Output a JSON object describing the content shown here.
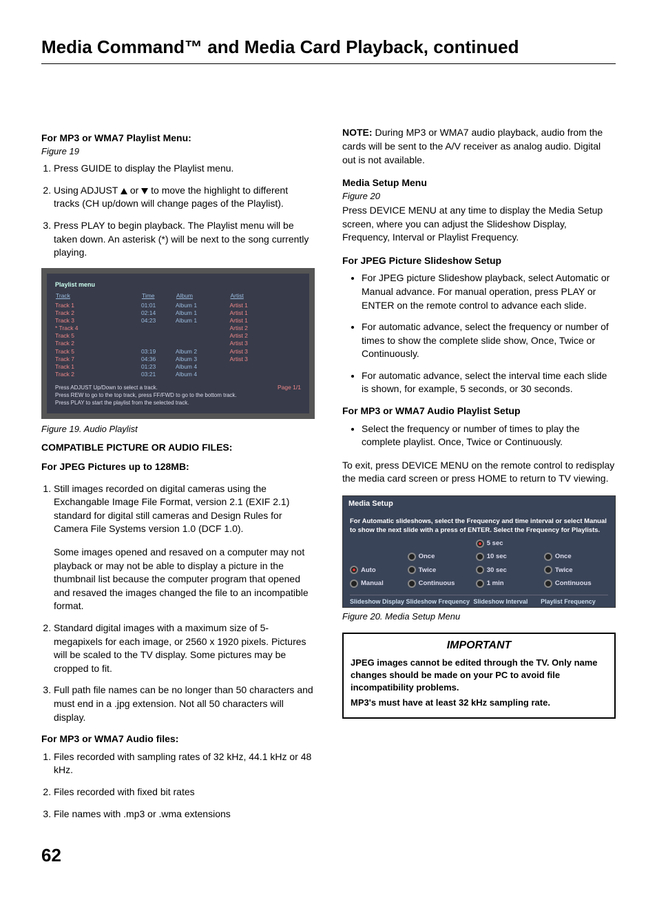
{
  "page_title": "Media Command™ and Media Card Playback, continued",
  "page_number": "62",
  "left": {
    "s1_head": "For MP3 or WMA7 Playlist Menu:",
    "s1_fig": "Figure 19",
    "s1_li1": "Press GUIDE to display the Playlist menu.",
    "s1_li2a": "Using ADJUST ",
    "s1_li2b": " or ",
    "s1_li2c": " to move the highlight to different tracks (CH up/down will change pages of the Playlist).",
    "s1_li3": "Press PLAY to begin playback.  The Playlist menu will be taken down. An asterisk (*) will be next to the song currently playing.",
    "fig19": {
      "title": "Playlist menu",
      "headers": [
        "Track",
        "Time",
        "Album",
        "Artist"
      ],
      "rows": [
        [
          "Track 1",
          "01:01",
          "Album 1",
          "Artist 1"
        ],
        [
          "Track 2",
          "02:14",
          "Album 1",
          "Artist 1"
        ],
        [
          "Track 3",
          "04:23",
          "Album 1",
          "Artist 1"
        ],
        [
          "* Track 4",
          "",
          "",
          "Artist 2"
        ],
        [
          "Track 5",
          "",
          "",
          "Artist 2"
        ],
        [
          "Track 2",
          "",
          "",
          "Artist 3"
        ],
        [
          "Track 5",
          "03:19",
          "Album 2",
          "Artist 3"
        ],
        [
          "Track 7",
          "04:36",
          "Album 3",
          "Artist 3"
        ],
        [
          "Track 1",
          "01:23",
          "Album 4",
          ""
        ],
        [
          "Track 2",
          "03:21",
          "Album 4",
          ""
        ]
      ],
      "page": "Page 1/1",
      "instr1": "Press ADJUST Up/Down to select a track.",
      "instr2": "Press REW to go to the top track, press FF/FWD to go to the bottom track.",
      "instr3": "Press PLAY to start the playlist from the selected track."
    },
    "fig19_caption": "Figure 19.  Audio Playlist",
    "s2_head1": "COMPATIBLE PICTURE OR AUDIO FILES:",
    "s2_head2": "For JPEG Pictures up to 128MB:",
    "s2_li1": "Still images recorded on digital cameras using the Exchangable Image File Format, version 2.1 (EXIF 2.1) standard for digital still cameras and Design Rules for Camera File Systems version 1.0 (DCF 1.0).",
    "s2_li1b": "Some images opened and resaved on a computer may not playback or may not be able to display a picture in the thumbnail list because the computer program that opened and resaved the images changed the file to an incompatible format.",
    "s2_li2": "Standard digital images with a maximum size of 5-megapixels for each image, or 2560 x 1920 pixels.  Pictures will be scaled to the TV display.  Some pictures may be cropped to fit.",
    "s2_li3": "Full path file names can be no longer than 50 characters and must end in a .jpg extension.  Not all 50 characters will display.",
    "s3_head": "For MP3 or WMA7 Audio files:",
    "s3_li1": "Files recorded with sampling rates of 32 kHz, 44.1 kHz or 48 kHz.",
    "s3_li2": "Files recorded with fixed bit rates",
    "s3_li3": "File names with .mp3 or .wma extensions"
  },
  "right": {
    "note_label": "NOTE:",
    "note_text": "  During MP3 or WMA7 audio playback, audio from the cards will be sent to the A/V receiver as analog audio.  Digital out is not available.",
    "s4_head": "Media Setup Menu",
    "s4_fig": "Figure 20",
    "s4_p": "Press DEVICE MENU at any time to display the Media Setup screen, where you can adjust the Slideshow Display, Frequency, Interval or Playlist Frequency.",
    "s5_head": "For JPEG Picture Slideshow Setup",
    "s5_li1": "For JPEG picture Slideshow playback, select Automatic or Manual advance.  For manual operation, press PLAY or ENTER on the remote control to advance each slide.",
    "s5_li2": "For automatic advance, select the frequency or number of times to show the complete slide show, Once, Twice or Continuously.",
    "s5_li3": "For automatic advance, select the interval time each slide is shown, for example, 5 seconds, or 30 seconds.",
    "s6_head": "For MP3 or WMA7 Audio Playlist Setup",
    "s6_li1": "Select the frequency or number of times to play the complete playlist.  Once, Twice or Continuously.",
    "exit_p": "To exit, press DEVICE MENU on the remote control to redisplay the media card screen or press HOME to return to TV viewing.",
    "fig20": {
      "title": "Media Setup",
      "intro": "For Automatic slideshows, select the Frequency and time interval or select Manual to show the next slide with a press of ENTER. Select the Frequency for Playlists.",
      "col1": [
        "",
        "Auto",
        "Manual"
      ],
      "col2": [
        "Once",
        "Twice",
        "Continuous"
      ],
      "col3": [
        "5 sec",
        "10 sec",
        "30 sec",
        "1 min"
      ],
      "col4": [
        "Once",
        "Twice",
        "Continuous"
      ],
      "labels": [
        "Slideshow Display",
        "Slideshow Frequency",
        "Slideshow Interval",
        "Playlist Frequency"
      ]
    },
    "fig20_caption": "Figure 20.  Media Setup Menu",
    "important_title": "IMPORTANT",
    "important_p1": "JPEG images cannot be edited through the TV.  Only name changes should be made on your PC to avoid file incompatibility problems.",
    "important_p2": "MP3's must have at least 32 kHz sampling rate."
  }
}
